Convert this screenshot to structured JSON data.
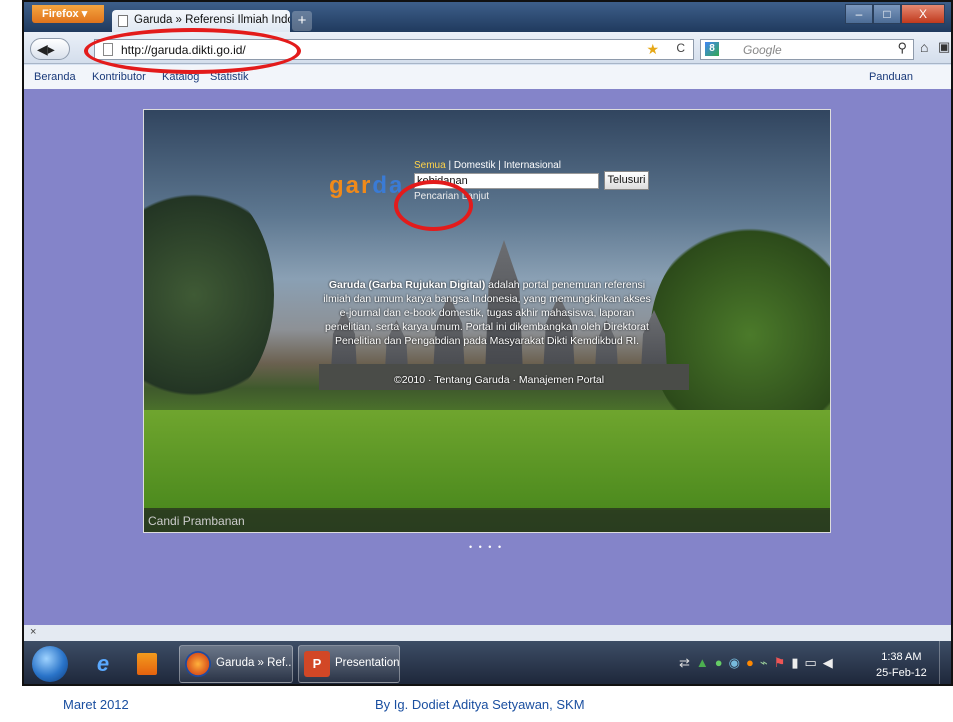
{
  "browser": {
    "menu_button": "Firefox",
    "tab_title": "Garuda » Referensi Ilmiah Indon...",
    "new_tab": "+",
    "window_controls": {
      "minimize": "–",
      "maximize": "□",
      "close": "X"
    },
    "url": "http://garuda.dikti.go.id/",
    "search_placeholder": "Google",
    "icons": [
      "back-icon",
      "forward-icon",
      "page-icon",
      "star-icon",
      "reload-icon",
      "google-icon",
      "search-icon",
      "home-icon",
      "addon-icon"
    ]
  },
  "bookmarks": [
    {
      "label": "Beranda"
    },
    {
      "label": "Kontributor"
    },
    {
      "label": "Katalog"
    },
    {
      "label": "Statistik"
    }
  ],
  "bookmark_right": "Panduan",
  "page": {
    "filters": {
      "all": "Semua",
      "sep1": " | ",
      "domestic": "Domestik",
      "sep2": " | ",
      "international": "Internasional"
    },
    "search_value": "kebidanan",
    "search_button": "Telusuri",
    "advanced_search": "Pencarian Lanjut",
    "logo": {
      "part_a": "gar",
      "part_b": "da"
    },
    "description_strong": "Garuda (Garba Rujukan Digital)",
    "description": " adalah portal penemuan referensi ilmiah dan umum karya bangsa Indonesia, yang memungkinkan akses e-journal dan e-book domestik, tugas akhir mahasiswa, laporan penelitian, serta karya umum. Portal ini dikembangkan oleh Direktorat Penelitian dan Pengabdian pada Masyarakat Dikti Kemdikbud RI.",
    "footer": "©2010 · Tentang Garuda · Manajemen Portal",
    "caption": "Candi Prambanan",
    "slide_dots": "• • • •"
  },
  "statusbar": {
    "close": "×"
  },
  "taskbar": {
    "tasks": [
      {
        "label": "Garuda » Ref..."
      },
      {
        "label": "Presentation..."
      }
    ],
    "ppt_icon_letter": "P",
    "tray_icons": [
      "network-icon",
      "shield-icon",
      "chat-icon",
      "update-icon",
      "antivirus-icon",
      "signal-icon",
      "flag-icon",
      "battery-icon",
      "display-icon",
      "volume-icon"
    ],
    "time": "1:38 AM",
    "date": "25-Feb-12"
  },
  "slide_footer": {
    "date": "Maret  2012",
    "author": "By Ig. Dodiet Aditya Setyawan, SKM"
  },
  "colors": {
    "page_background": "#8484c9",
    "annotation": "#e31b1b",
    "footer_text": "#1a4fa0"
  }
}
